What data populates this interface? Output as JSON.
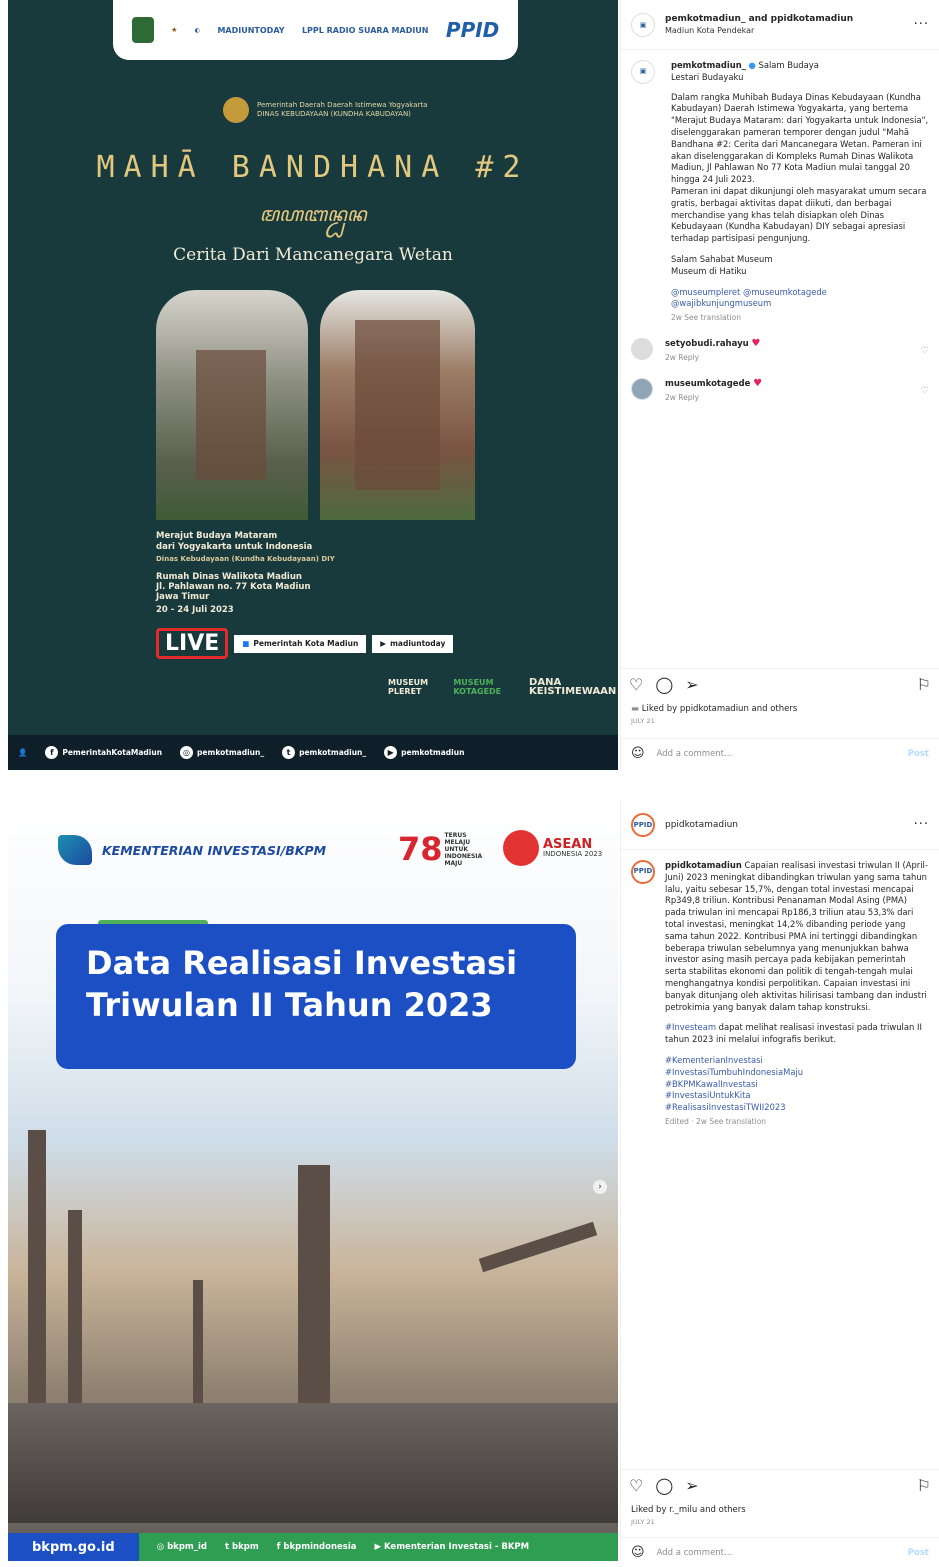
{
  "post1": {
    "image": {
      "logos": [
        "KOTA MADIUN",
        "MADIUN Kota Pendekar",
        "KOMINFO",
        "MADIUNTODAY",
        "LPPL RADIO SUARA MADIUN",
        "PPID"
      ],
      "gov_line1": "Pemerintah Daerah Daerah Istimewa Yogyakarta",
      "gov_line2": "DINAS KEBUDAYAAN (KUNDHA KABUDAYAN)",
      "title": "MAHĀ BANDHANA #2",
      "javanese": "ꦩꦲꦧꦤ꧀ꦝꦤ",
      "subtitle": "Cerita Dari Mancanegara Wetan",
      "info1": "Merajut Budaya Mataram",
      "info2": "dari Yogyakarta untuk Indonesia",
      "info3": "Dinas Kebudayaan (Kundha Kebudayaan) DIY",
      "addr1": "Rumah Dinas Walikota Madiun",
      "addr2": "Jl. Pahlawan no. 77 Kota Madiun",
      "addr3": "Jawa Timur",
      "dates": "20 - 24 Juli 2023",
      "live": "LIVE",
      "live_fb": "Pemerintah Kota Madiun",
      "live_yt": "madiuntoday",
      "partner1": "MUSEUM PLERET",
      "partner2": "MUSEUM KOTAGEDE",
      "partner3": "DANA KEISTIMEWAAN",
      "footer": [
        "PemerintahKotaMadiun",
        "pemkotmadiun_",
        "pemkotmadiun_",
        "pemkotmadiun"
      ]
    },
    "header": {
      "names": "pemkotmadiun_ and ppidkotamadiun",
      "location": "Madiun Kota Pendekar"
    },
    "caption": {
      "username": "pemkotmadiun_",
      "line1": "Salam Budaya",
      "line2": "Lestari Budayaku",
      "para1": "Dalam rangka Muhibah Budaya Dinas Kebudayaan (Kundha Kabudayan) Daerah Istimewa Yogyakarta, yang bertema \"Merajut Budaya Mataram: dari Yogyakarta untuk Indonesia\", diselenggarakan pameran temporer dengan judul \"Mahā Bandhana #2: Cerita dari Mancanegara Wetan. Pameran ini akan diselenggarakan di Kompleks Rumah Dinas Walikota Madiun, Jl Pahlawan No 77 Kota Madiun mulai tanggal 20 hingga 24 Juli 2023.\nPameran ini dapat dikunjungi oleh masyarakat umum secara gratis, berbagai aktivitas dapat diikuti, dan berbagai merchandise yang khas telah disiapkan oleh Dinas Kebudayaan (Kundha Kabudayan) DIY sebagai apresiasi terhadap partisipasi pengunjung.",
      "para2": "Salam Sahabat Museum\nMuseum di Hatiku",
      "tags": "@museumpleret @museumkotagede @wajibkunjungmuseum",
      "meta": "2w   See translation"
    },
    "comments": [
      {
        "user": "setyobudi.rahayu",
        "meta": "2w   Reply"
      },
      {
        "user": "museumkotagede",
        "meta": "2w   Reply"
      }
    ],
    "liked": "Liked by ppidkotamadiun and others",
    "date": "JULY 21",
    "add_comment": "Add a comment...",
    "post_btn": "Post"
  },
  "post2": {
    "image": {
      "ministry": "KEMENTERIAN INVESTASI/BKPM",
      "r78_num": "78",
      "r78_text": "TERUS MELAJU UNTUK INDONESIA MAJU",
      "asean": "ASEAN",
      "asean_sub": "INDONESIA 2023",
      "title_line1": "Data Realisasi Investasi",
      "title_line2": "Triwulan II Tahun 2023",
      "site": "bkpm.go.id",
      "footer": [
        "bkpm_id",
        "bkpm",
        "bkpmindonesia",
        "Kementerian Investasi - BKPM"
      ]
    },
    "header": {
      "names": "ppidkotamadiun"
    },
    "caption": {
      "username": "ppidkotamadiun",
      "para1": "Capaian realisasi investasi triwulan II (April-Juni) 2023 meningkat dibandingkan triwulan yang sama tahun lalu, yaitu sebesar 15,7%, dengan total investasi mencapai Rp349,8 triliun. Kontribusi Penanaman Modal Asing (PMA) pada triwulan ini mencapai Rp186,3 triliun atau 53,3% dari total investasi, meningkat 14,2% dibanding periode yang sama tahun 2022. Kontribusi PMA ini tertinggi dibandingkan beberapa triwulan sebelumnya yang menunjukkan bahwa investor asing masih percaya pada kebijakan pemerintah serta stabilitas ekonomi dan politik di tengah-tengah mulai menghangatnya kondisi perpolitikan. Capaian investasi ini banyak ditunjang oleh aktivitas hilirisasi tambang dan industri petrokimia yang banyak dalam tahap konstruksi.",
      "hashtag_lead": "#Investeam",
      "para2": " dapat melihat realisasi investasi pada triwulan II tahun 2023 ini melalui infografis berikut.",
      "tags": "#KementerianInvestasi\n#InvestasiTumbuhIndonesiaMaju\n#BKPMKawalInvestasi\n#InvestasiUntukKita\n#RealisasiInvestasiTWII2023",
      "meta": "Edited · 2w   See translation"
    },
    "liked": "Liked by r._milu and others",
    "date": "JULY 21",
    "add_comment": "Add a comment...",
    "post_btn": "Post"
  },
  "icons": [
    "heart-icon",
    "comment-icon",
    "share-icon",
    "bookmark-icon",
    "more-icon",
    "emoji-icon"
  ],
  "colors": {
    "link": "#3a5ba8",
    "heart": "#e0245e",
    "post1_bg": "#183a3c",
    "bkpm_blue": "#1c4fc4",
    "bkpm_green": "#2f9e52"
  }
}
